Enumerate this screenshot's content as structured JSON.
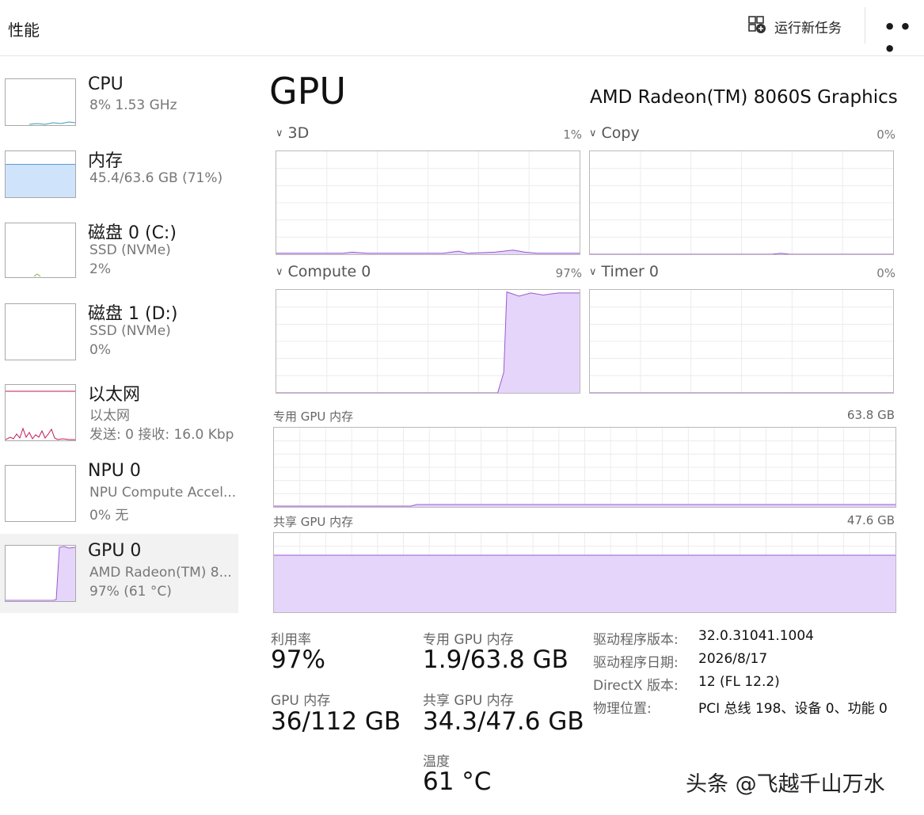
{
  "header": {
    "title": "性能",
    "run_task_label": "运行新任务",
    "run_task_icon": "run-task-icon",
    "more_icon": "more-icon"
  },
  "sidebar": {
    "items": [
      {
        "name": "CPU",
        "sub1": "8%  1.53 GHz",
        "sub2": ""
      },
      {
        "name": "内存",
        "sub1": "45.4/63.6 GB (71%)",
        "sub2": ""
      },
      {
        "name": "磁盘 0 (C:)",
        "sub1": "SSD (NVMe)",
        "sub2": "2%"
      },
      {
        "name": "磁盘 1 (D:)",
        "sub1": "SSD (NVMe)",
        "sub2": "0%"
      },
      {
        "name": "以太网",
        "sub1": "以太网",
        "sub2": "发送: 0 接收: 16.0 Kbp"
      },
      {
        "name": "NPU 0",
        "sub1": "NPU Compute Accel...",
        "sub2": "0% 无"
      },
      {
        "name": "GPU 0",
        "sub1": "AMD Radeon(TM) 8...",
        "sub2": "97% (61 °C)"
      }
    ],
    "selected_index": 6
  },
  "main": {
    "title": "GPU",
    "model": "AMD Radeon(TM) 8060S Graphics",
    "engines": [
      {
        "label": "3D",
        "percent": "1%"
      },
      {
        "label": "Copy",
        "percent": "0%"
      },
      {
        "label": "Compute 0",
        "percent": "97%"
      },
      {
        "label": "Timer 0",
        "percent": "0%"
      }
    ],
    "dedicated_mem": {
      "label": "专用 GPU 内存",
      "max": "63.8 GB"
    },
    "shared_mem": {
      "label": "共享 GPU 内存",
      "max": "47.6 GB"
    }
  },
  "stats": {
    "utilization_label": "利用率",
    "utilization": "97%",
    "gpu_mem_label": "GPU 内存",
    "gpu_mem": "36/112 GB",
    "dedicated_label": "专用 GPU 内存",
    "dedicated": "1.9/63.8 GB",
    "shared_label": "共享 GPU 内存",
    "shared": "34.3/47.6 GB",
    "temp_label": "温度",
    "temp": "61 °C"
  },
  "info": [
    {
      "key": "驱动程序版本:",
      "value": "32.0.31041.1004"
    },
    {
      "key": "驱动程序日期:",
      "value": "2026/8/17"
    },
    {
      "key": "DirectX 版本:",
      "value": "12 (FL 12.2)"
    },
    {
      "key": "物理位置:",
      "value": "PCI 总线 198、设备 0、功能 0"
    }
  ],
  "watermark": "头条 @飞越千山万水",
  "colors": {
    "gpu_line": "#9b59d0",
    "gpu_fill": "#e6d5fa",
    "mem_fill": "#cfe3fb",
    "mem_line": "#5a9bd6",
    "eth_line": "#c2185b",
    "cpu_line": "#3a9bb5"
  },
  "usage": {
    "gpu_3d": 0.01,
    "gpu_compute": 0.97,
    "dedicated_mem": 0.03,
    "shared_mem": 0.72,
    "memory": 0.71,
    "disk0": 0.02
  }
}
